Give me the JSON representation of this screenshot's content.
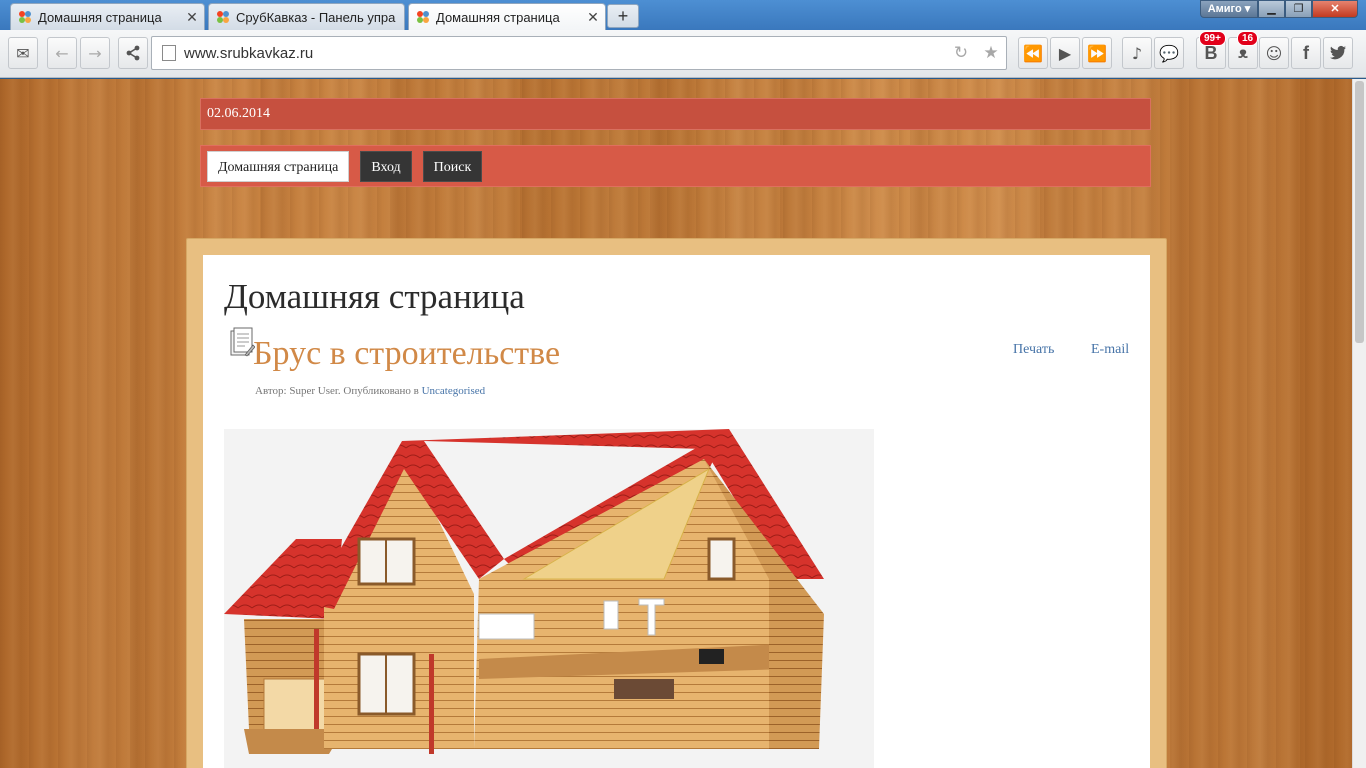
{
  "browser": {
    "tabs": [
      {
        "label": "Домашняя страница"
      },
      {
        "label": "СрубКавказ - Панель упра"
      },
      {
        "label": "Домашняя страница"
      }
    ],
    "new_tab_label": "+",
    "profile_label": "Амиго",
    "address": "www.srubkavkaz.ru",
    "badges": {
      "vk": "99+",
      "ok": "16"
    }
  },
  "site": {
    "date": "02.06.2014",
    "nav": [
      {
        "label": "Домашняя страница"
      },
      {
        "label": "Вход"
      },
      {
        "label": "Поиск"
      }
    ],
    "page_heading": "Домашняя страница",
    "article": {
      "title": "Брус в строительстве",
      "print_label": "Печать",
      "email_label": "E-mail",
      "meta_prefix": "Автор: Super User. Опубликовано в",
      "category": "Uncategorised"
    }
  },
  "colors": {
    "date_bar": "#c6503f",
    "nav_bar": "#d75a47",
    "title_accent": "#d18947",
    "link": "#4774a8"
  }
}
